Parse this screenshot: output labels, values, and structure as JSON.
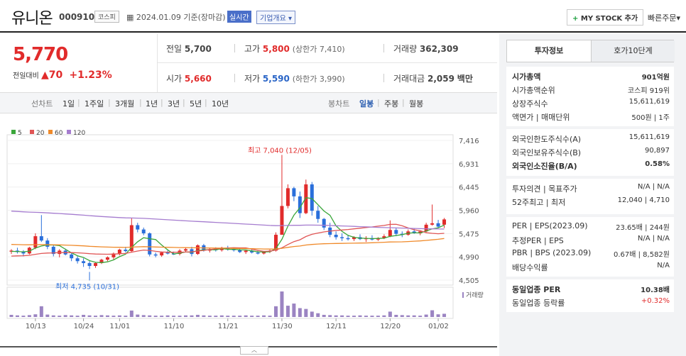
{
  "header": {
    "name": "유니온",
    "code": "000910",
    "market_badge": "코스피",
    "date_text": "2024.01.09 기준(장마감)",
    "live_label": "실시간",
    "overview_label": "기업개요",
    "mystock_plus": "+",
    "mystock_label": "MY STOCK 추가",
    "quick_order_label": "빠른주문"
  },
  "price": {
    "current": "5,770",
    "change_label": "전일대비",
    "change_arrow": "▲",
    "change_value": "70",
    "change_pct": "+1.23%"
  },
  "stats": {
    "prev_close_label": "전일",
    "prev_close": "5,700",
    "high_label": "고가",
    "high": "5,800",
    "upper_limit": "(상한가 7,410)",
    "volume_label": "거래량",
    "volume": "362,309",
    "open_label": "시가",
    "open": "5,660",
    "low_label": "저가",
    "low": "5,590",
    "lower_limit": "(하한가 3,990)",
    "amount_label": "거래대금",
    "amount": "2,059",
    "amount_unit": "백만"
  },
  "period_tabs": {
    "line_label": "선차트",
    "line_items": [
      "1일",
      "1주일",
      "3개월",
      "1년",
      "3년",
      "5년",
      "10년"
    ],
    "candle_label": "봉차트",
    "candle_items": [
      "일봉",
      "주봉",
      "월봉"
    ],
    "candle_active": "일봉"
  },
  "chart_data": {
    "type": "candlestick",
    "legend": [
      {
        "name": "5",
        "color": "#3aa63a"
      },
      {
        "name": "20",
        "color": "#e05555"
      },
      {
        "name": "60",
        "color": "#f08a2a"
      },
      {
        "name": "120",
        "color": "#a57ccf"
      }
    ],
    "y_ticks": [
      7416,
      6931,
      6445,
      5960,
      5475,
      4990,
      4505
    ],
    "ylim": [
      4505,
      7416
    ],
    "x_ticks": [
      "10/13",
      "10/24",
      "11/01",
      "11/10",
      "11/21",
      "11/30",
      "12/11",
      "12/20",
      "01/02"
    ],
    "max_annotation": "최고 7,040 (12/05)",
    "min_annotation": "최저 4,735 (10/31)",
    "volume_label": "거래량",
    "candles": [
      [
        5100,
        5150,
        5050,
        5120
      ],
      [
        5120,
        5180,
        5060,
        5090
      ],
      [
        5090,
        5130,
        5000,
        5060
      ],
      [
        5060,
        5200,
        5040,
        5180
      ],
      [
        5180,
        5480,
        5150,
        5420
      ],
      [
        5420,
        5860,
        5300,
        5330
      ],
      [
        5330,
        5380,
        5150,
        5200
      ],
      [
        5200,
        5240,
        5000,
        5050
      ],
      [
        5050,
        5150,
        4980,
        5120
      ],
      [
        5120,
        5160,
        5020,
        5040
      ],
      [
        5040,
        5080,
        4900,
        4960
      ],
      [
        4960,
        5000,
        4850,
        4900
      ],
      [
        4900,
        4960,
        4780,
        4860
      ],
      [
        4860,
        4900,
        4735,
        4800
      ],
      [
        4800,
        4880,
        4760,
        4860
      ],
      [
        4860,
        4950,
        4840,
        4930
      ],
      [
        4930,
        5000,
        4900,
        4980
      ],
      [
        4980,
        5080,
        4940,
        5060
      ],
      [
        5060,
        5160,
        5020,
        5140
      ],
      [
        5140,
        5200,
        5080,
        5110
      ],
      [
        5110,
        5800,
        5080,
        5650
      ],
      [
        5650,
        5700,
        5500,
        5560
      ],
      [
        5560,
        5600,
        5440,
        5480
      ],
      [
        5480,
        5500,
        5000,
        5040
      ],
      [
        5040,
        5080,
        4980,
        5020
      ],
      [
        5020,
        5100,
        4990,
        5080
      ],
      [
        5080,
        5120,
        5040,
        5060
      ],
      [
        5060,
        5100,
        5030,
        5050
      ],
      [
        5050,
        5150,
        5020,
        5120
      ],
      [
        5120,
        5180,
        5080,
        5150
      ],
      [
        5150,
        5200,
        5000,
        5050
      ],
      [
        5050,
        5250,
        5030,
        5230
      ],
      [
        5230,
        5260,
        5100,
        5120
      ],
      [
        5120,
        5170,
        5080,
        5150
      ],
      [
        5150,
        5190,
        5100,
        5130
      ],
      [
        5130,
        5200,
        5100,
        5180
      ],
      [
        5180,
        5220,
        5120,
        5150
      ],
      [
        5150,
        5180,
        5100,
        5130
      ],
      [
        5130,
        5160,
        5070,
        5090
      ],
      [
        5090,
        5140,
        5050,
        5120
      ],
      [
        5120,
        5160,
        5060,
        5080
      ],
      [
        5080,
        5120,
        5040,
        5060
      ],
      [
        5060,
        5110,
        5040,
        5100
      ],
      [
        5100,
        5140,
        5070,
        5120
      ],
      [
        5120,
        5500,
        5100,
        5450
      ],
      [
        5450,
        7040,
        5900,
        6050
      ],
      [
        6050,
        6500,
        6000,
        6420
      ],
      [
        6420,
        6450,
        6150,
        6250
      ],
      [
        6250,
        6350,
        5800,
        5900
      ],
      [
        5900,
        6600,
        5880,
        6500
      ],
      [
        6500,
        6550,
        5850,
        5950
      ],
      [
        5950,
        6050,
        5700,
        5780
      ],
      [
        5780,
        5800,
        5550,
        5600
      ],
      [
        5600,
        5700,
        5400,
        5450
      ],
      [
        5450,
        5520,
        5350,
        5400
      ],
      [
        5400,
        5480,
        5320,
        5380
      ],
      [
        5380,
        5450,
        5330,
        5360
      ],
      [
        5360,
        5420,
        5320,
        5400
      ],
      [
        5400,
        5460,
        5340,
        5360
      ],
      [
        5360,
        5420,
        5300,
        5380
      ],
      [
        5380,
        5440,
        5330,
        5350
      ],
      [
        5350,
        5400,
        5320,
        5380
      ],
      [
        5380,
        5460,
        5360,
        5420
      ],
      [
        5420,
        5750,
        5400,
        5550
      ],
      [
        5550,
        5600,
        5420,
        5470
      ],
      [
        5470,
        5520,
        5400,
        5450
      ],
      [
        5450,
        5560,
        5430,
        5520
      ],
      [
        5520,
        5580,
        5470,
        5480
      ],
      [
        5480,
        5540,
        5440,
        5520
      ],
      [
        5520,
        5700,
        5500,
        5660
      ],
      [
        5660,
        6080,
        5640,
        5690
      ],
      [
        5690,
        5760,
        5600,
        5620
      ],
      [
        5660,
        5800,
        5590,
        5770
      ]
    ],
    "volumes": [
      8,
      6,
      5,
      7,
      10,
      40,
      9,
      6,
      5,
      7,
      6,
      5,
      8,
      6,
      5,
      7,
      6,
      5,
      6,
      5,
      24,
      9,
      7,
      6,
      5,
      5,
      6,
      5,
      5,
      6,
      6,
      8,
      6,
      5,
      5,
      6,
      5,
      5,
      5,
      6,
      5,
      5,
      6,
      5,
      40,
      95,
      42,
      50,
      33,
      30,
      20,
      14,
      8,
      7,
      6,
      6,
      5,
      5,
      6,
      5,
      5,
      5,
      6,
      20,
      8,
      7,
      6,
      6,
      5,
      9,
      25,
      10,
      12
    ]
  },
  "right_panel": {
    "tab_active": "투자정보",
    "tab_other": "호가10단계",
    "s1": [
      {
        "label": "시가총액",
        "value": "901억원",
        "bold": true
      },
      {
        "label": "시가총액순위",
        "value": "코스피 919위"
      },
      {
        "label": "상장주식수",
        "value": "15,611,619"
      },
      {
        "label": "액면가 | 매매단위",
        "value": "500원 | 1주"
      }
    ],
    "s2": [
      {
        "label": "외국인한도주식수(A)",
        "value": "15,611,619"
      },
      {
        "label": "외국인보유주식수(B)",
        "value": "90,897"
      },
      {
        "label": "외국인소진율(B/A)",
        "value": "0.58%",
        "bold": true
      }
    ],
    "s3": [
      {
        "label": "투자의견 | 목표주가",
        "value": "N/A | N/A"
      },
      {
        "label": "52주최고 | 최저",
        "value": "12,040 | 4,710"
      }
    ],
    "s4": [
      {
        "label": "PER | EPS(2023.09)",
        "value": "23.65배 | 244원"
      },
      {
        "label": "추정PER | EPS",
        "value": "N/A | N/A"
      },
      {
        "label": "PBR | BPS (2023.09)",
        "value": "0.67배 | 8,582원"
      },
      {
        "label": "배당수익률",
        "value": "N/A"
      }
    ],
    "s5": [
      {
        "label": "동일업종 PER",
        "value": "10.38배",
        "bold": true
      },
      {
        "label": "동일업종 등락률",
        "value": "+0.32%",
        "red": true
      }
    ]
  }
}
